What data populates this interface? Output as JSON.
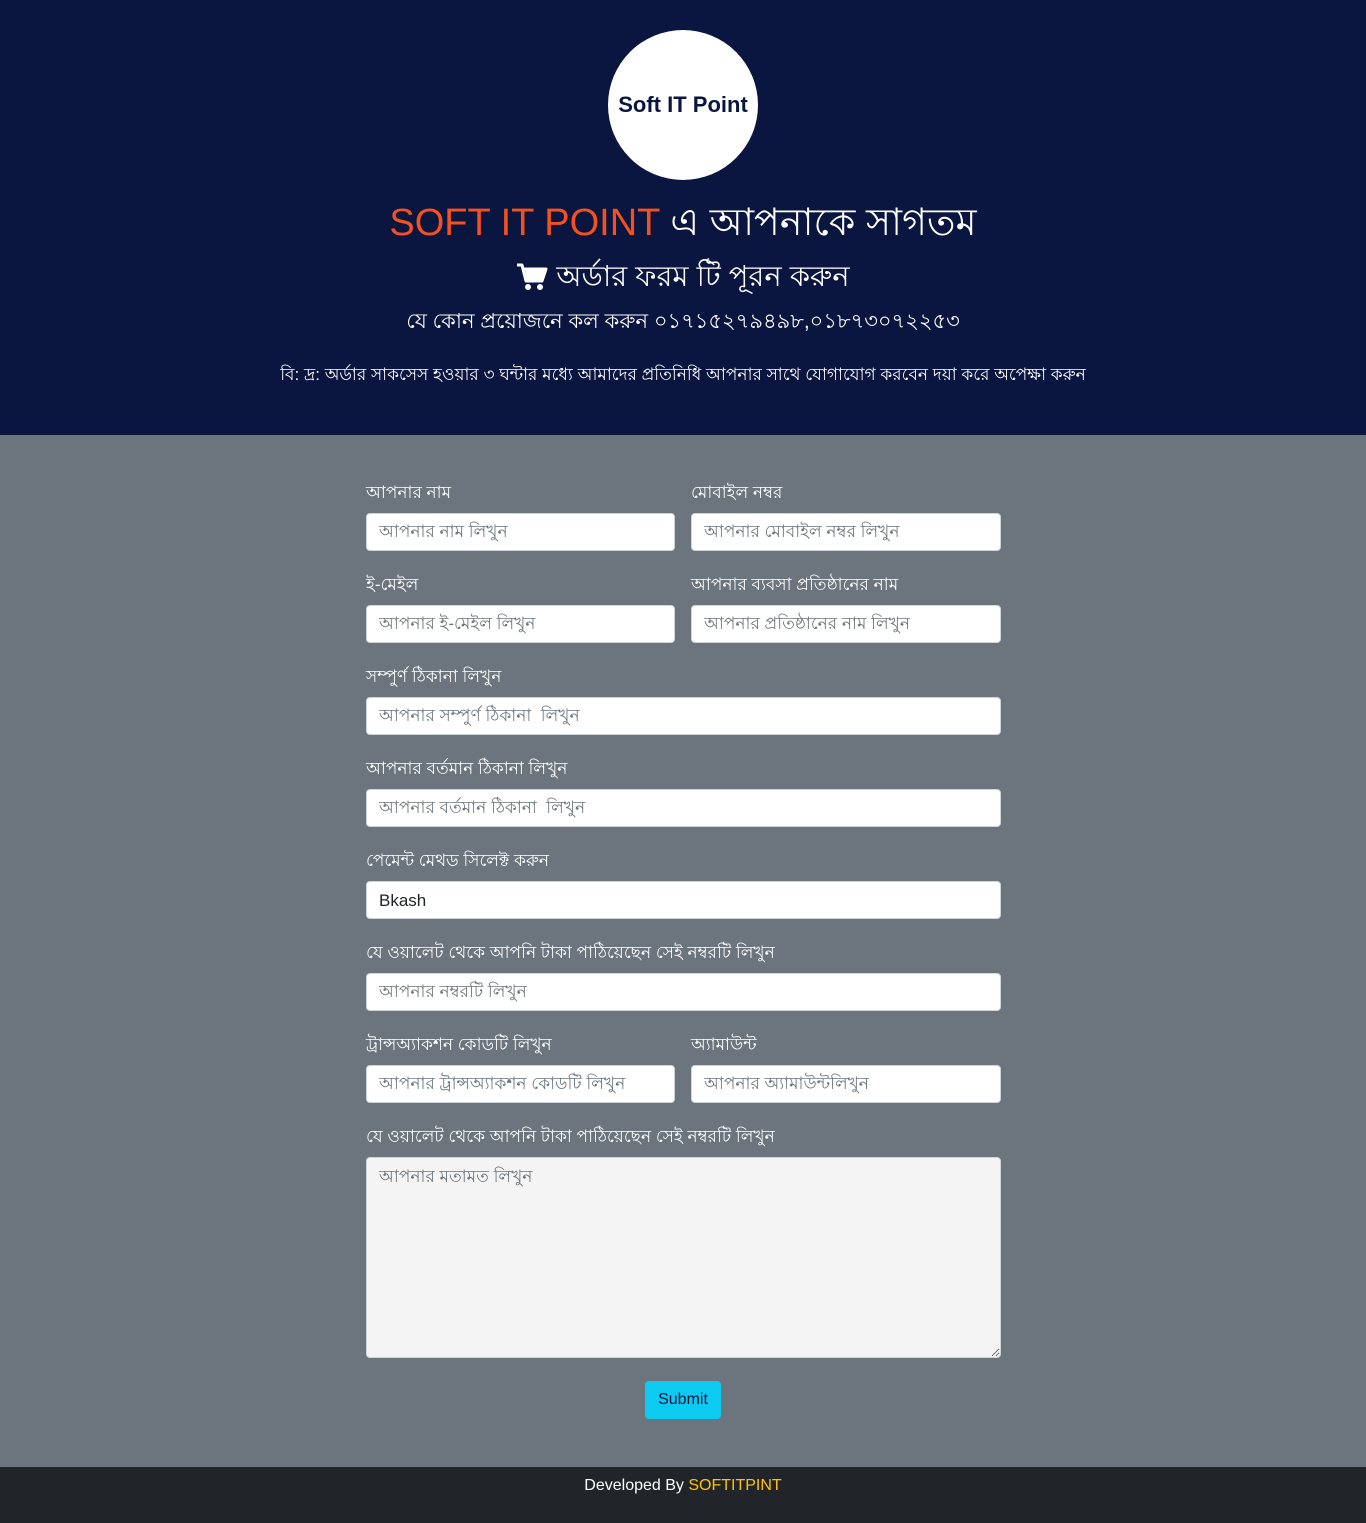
{
  "header": {
    "logo_text": "Soft IT Point",
    "title_brand": "SOFT IT POINT",
    "title_rest": " এ আপনাকে সাগতম",
    "subtitle": "অর্ডার ফরম টি পূরন করুন",
    "call_line": "যে কোন প্রয়োজনে কল করুন ০১৭১৫২৭৯৪৯৮,০১৮৭৩০৭২২৫৩",
    "note": "বি: দ্র: অর্ডার সাকসেস হওয়ার ৩ ঘন্টার মধ্যে আমাদের প্রতিনিধি আপনার সাথে যোগাযোগ করবেন দয়া করে অপেক্ষা করুন",
    "brand_color": "#f4511e",
    "icon": "cart-icon"
  },
  "form": {
    "name": {
      "label": "আপনার নাম",
      "placeholder": "আপনার নাম লিখুন"
    },
    "mobile": {
      "label": "মোবাইল নম্বর",
      "placeholder": "আপনার মোবাইল নম্বর লিখুন"
    },
    "email": {
      "label": "ই-মেইল",
      "placeholder": "আপনার ই-মেইল লিখুন"
    },
    "business": {
      "label": "আপনার ব্যবসা প্রতিষ্ঠানের নাম",
      "placeholder": "আপনার প্রতিষ্ঠানের নাম লিখুন"
    },
    "full_address": {
      "label": "সম্পুর্ণ ঠিকানা লিখুন",
      "placeholder": "আপনার সম্পুর্ণ ঠিকানা  লিখুন"
    },
    "current_address": {
      "label": "আপনার বর্তমান ঠিকানা লিখুন",
      "placeholder": "আপনার বর্তমান ঠিকানা  লিখুন"
    },
    "payment": {
      "label": "পেমেন্ট মেথড সিলেক্ট করুন",
      "selected": "Bkash"
    },
    "wallet_number": {
      "label": "যে ওয়ালেট থেকে আপনি টাকা পাঠিয়েছেন সেই নম্বরটি লিখুন",
      "placeholder": "আপনার নম্বরটি লিখুন"
    },
    "transaction": {
      "label": "ট্রান্সঅ্যাকশন কোডটি লিখুন",
      "placeholder": "আপনার ট্রান্সঅ্যাকশন কোডটি লিখুন"
    },
    "amount": {
      "label": "অ্যামাউন্ট",
      "placeholder": "আপনার অ্যামাউন্টলিখুন"
    },
    "comment": {
      "label": "যে ওয়ালেট থেকে আপনি টাকা পাঠিয়েছেন সেই নম্বরটি লিখুন",
      "placeholder": "আপনার মতামত লিখুন"
    },
    "submit_label": "Submit",
    "submit_color": "#0dcaf0"
  },
  "footer": {
    "prefix": "Developed By ",
    "brand": "SOFTITPINT",
    "brand_color": "#ffc107"
  }
}
